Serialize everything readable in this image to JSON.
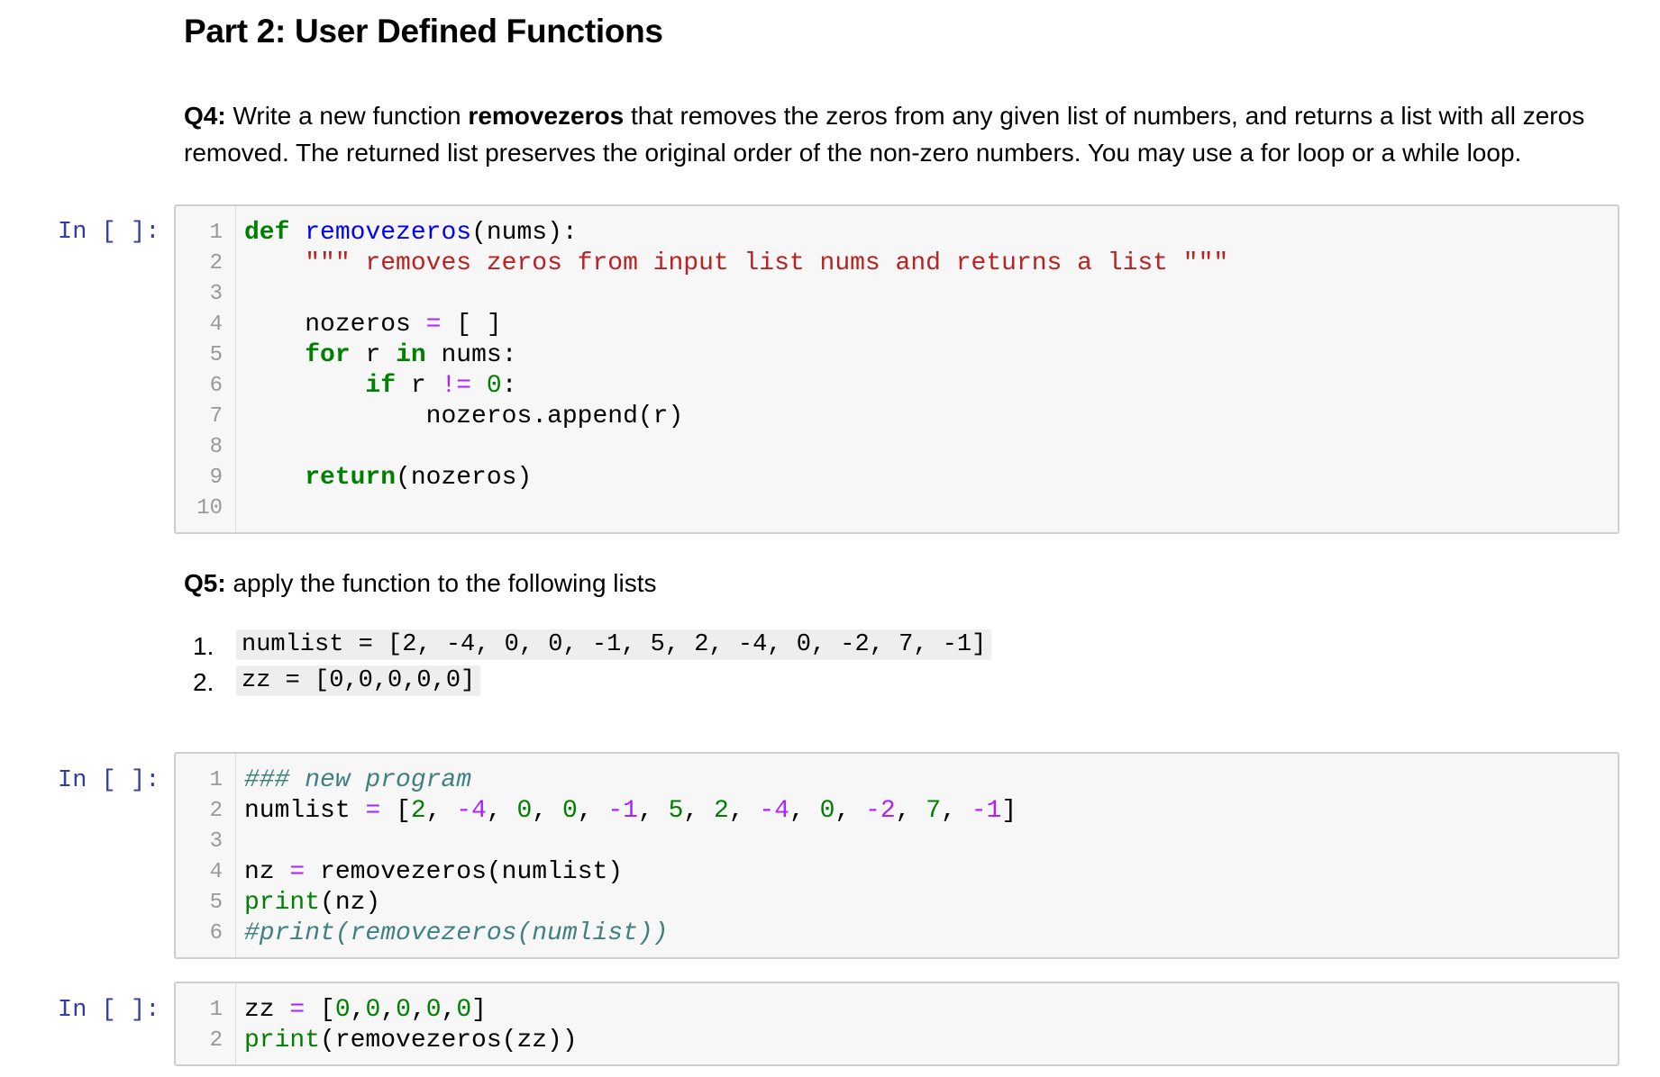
{
  "part_title": "Part 2: User Defined Functions",
  "q4": {
    "label": "Q4:",
    "text_before": " Write a new function ",
    "func_name": "removezeros",
    "text_after": " that removes the zeros from any given list of numbers, and returns a list with all zeros removed. The returned list preserves the original order of the non-zero numbers. You may use a for loop or a while loop."
  },
  "q5": {
    "label": "Q5:",
    "text": " apply the function to the following lists",
    "items": [
      {
        "num": "1.",
        "code": "numlist = [2, -4, 0, 0, -1, 5, 2, -4, 0, -2, 7, -1]"
      },
      {
        "num": "2.",
        "code": "zz = [0,0,0,0,0]"
      }
    ]
  },
  "prompt_label": "In [ ]:",
  "cell1": {
    "line_numbers": [
      "1",
      "2",
      "3",
      "4",
      "5",
      "6",
      "7",
      "8",
      "9",
      "10"
    ],
    "t": {
      "def": "def",
      "name": "removezeros",
      "sig": "(nums):",
      "doc": "\"\"\" removes zeros from input list nums and returns a list \"\"\"",
      "noz": "nozeros",
      "eq": "=",
      "brk": "[ ]",
      "for": "for",
      "r": "r",
      "in": "in",
      "nums": "nums:",
      "if": "if",
      "ne": "!=",
      "zero": "0",
      "colon": ":",
      "append": "nozeros.append(r)",
      "ret": "return",
      "retarg": "(nozeros)"
    }
  },
  "cell2": {
    "line_numbers": [
      "1",
      "2",
      "3",
      "4",
      "5",
      "6"
    ],
    "t": {
      "comment1": "### new program",
      "numlist": "numlist",
      "eq": "=",
      "l_open": "[",
      "v1": "2",
      "sep": ", ",
      "m4": "-4",
      "z": "0",
      "m1": "-1",
      "v5": "5",
      "m2": "-2",
      "v7": "7",
      "l_close": "]",
      "nz": "nz",
      "call": "removezeros(numlist)",
      "print": "print",
      "printarg": "(nz)",
      "comment2": "#print(removezeros(numlist))"
    }
  },
  "cell3": {
    "line_numbers": [
      "1",
      "2"
    ],
    "t": {
      "zz": "zz",
      "eq": "=",
      "open": "[",
      "z": "0",
      "comma": ",",
      "close": "]",
      "print": "print",
      "printarg": "(removezeros(zz))"
    }
  }
}
